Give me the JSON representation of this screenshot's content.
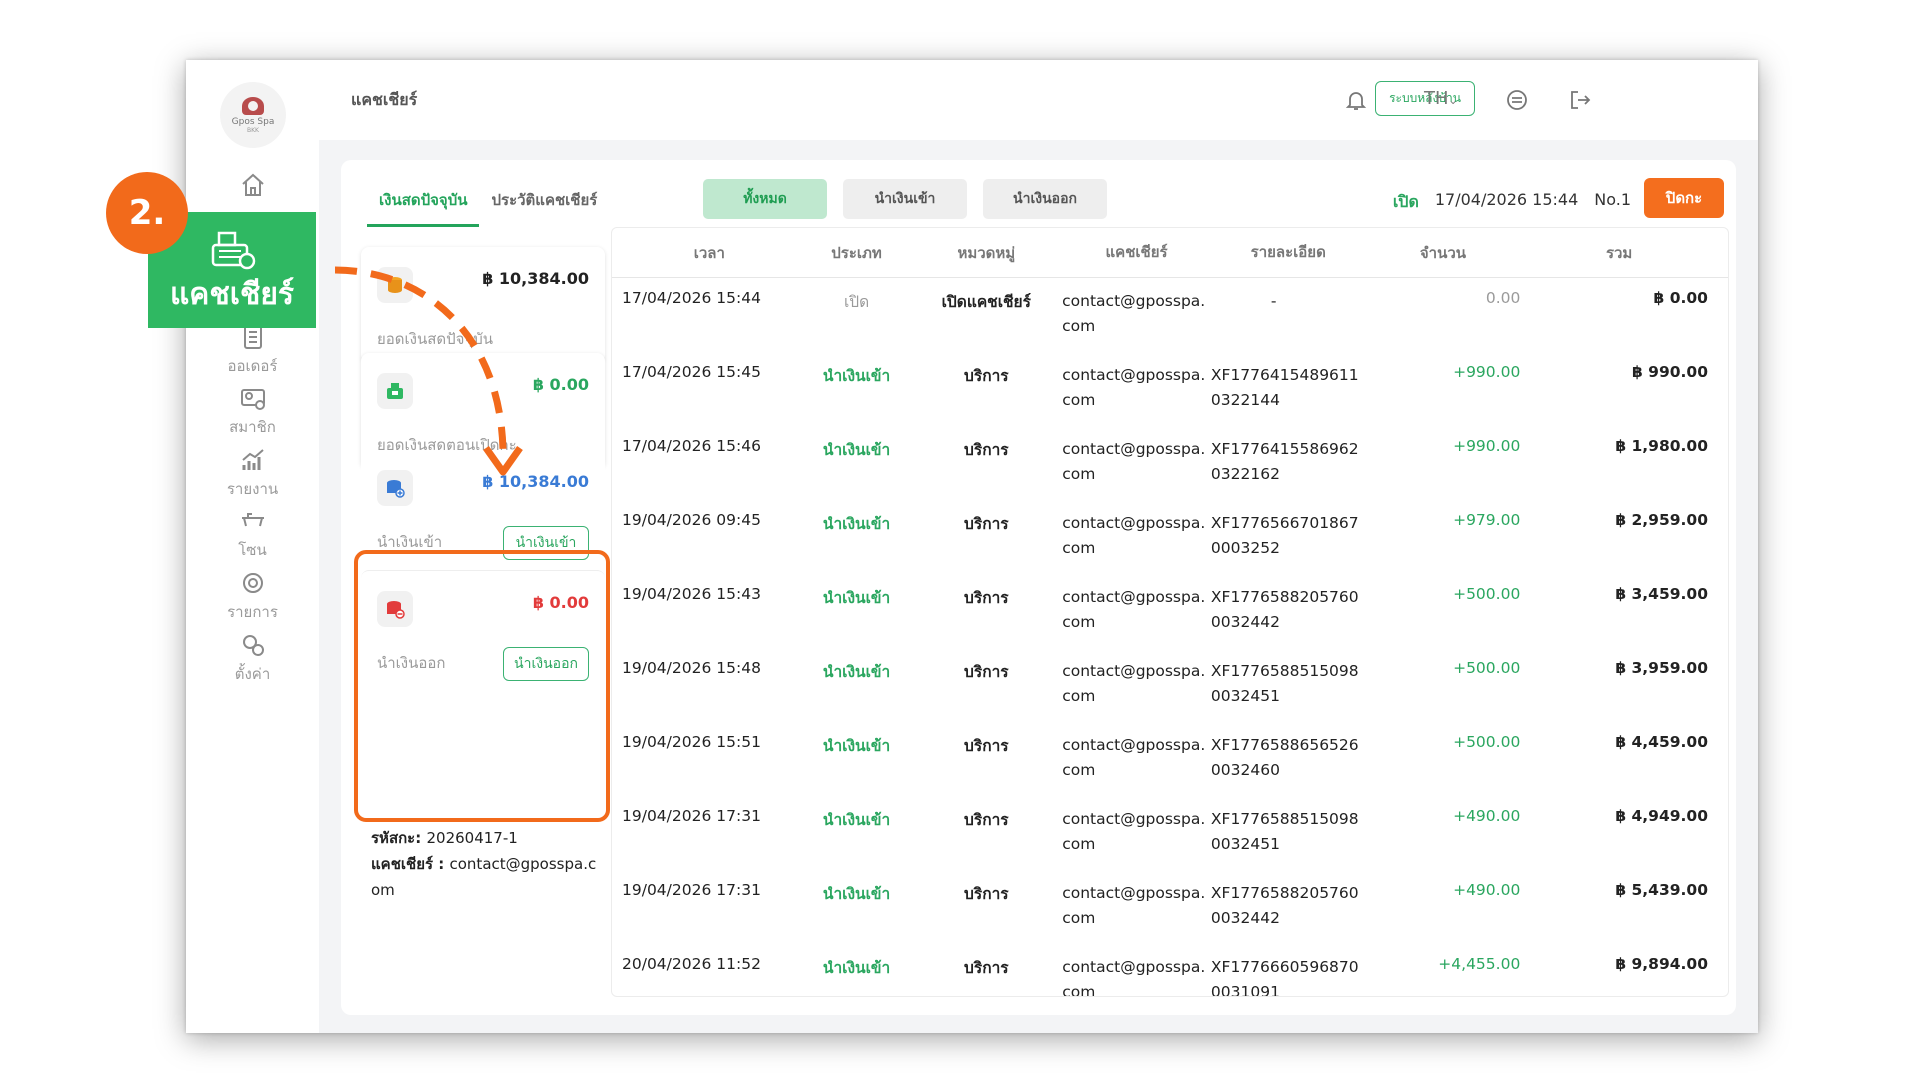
{
  "step_badge": "2.",
  "callout_label": "แคชเชียร์",
  "sidebar": {
    "logo_name": "Gpos Spa",
    "logo_sub": "BKK",
    "items": [
      {
        "label": "",
        "icon": "home-icon"
      },
      {
        "label": "",
        "icon": "cash-register-icon"
      },
      {
        "label": "ออเดอร์",
        "icon": "order-list-icon"
      },
      {
        "label": "สมาชิก",
        "icon": "member-card-icon"
      },
      {
        "label": "รายงาน",
        "icon": "report-chart-icon"
      },
      {
        "label": "โซน",
        "icon": "zone-bed-icon"
      },
      {
        "label": "รายการ",
        "icon": "item-list-icon"
      },
      {
        "label": "ตั้งค่า",
        "icon": "settings-gear-icon"
      }
    ]
  },
  "topbar": {
    "title": "แคชเชียร์",
    "backoffice_label": "ระบบหลังบ้าน",
    "language": "TH"
  },
  "tabs": [
    "เงินสดปัจจุบัน",
    "ประวัติแคชเชียร์"
  ],
  "filters": [
    "ทั้งหมด",
    "นำเงินเข้า",
    "นำเงินออก"
  ],
  "open_info": {
    "status": "เปิด",
    "datetime": "17/04/2026 15:44",
    "shift_no": "No.1",
    "close_button": "ปิดกะ"
  },
  "cards": [
    {
      "amount": "฿ 10,384.00",
      "label": "ยอดเงินสดปัจจุบัน"
    },
    {
      "amount": "฿ 0.00",
      "label": "ยอดเงินสดตอนเปิดกะ"
    },
    {
      "amount": "฿ 10,384.00",
      "label": "นำเงินเข้า",
      "button": "นำเงินเข้า"
    },
    {
      "amount": "฿ 0.00",
      "label": "นำเงินออก",
      "button": "นำเงินออก"
    }
  ],
  "meta": {
    "shift_code_label": "รหัสกะ:",
    "shift_code": "20260417-1",
    "cashier_label": "แคชเชียร์ :",
    "cashier": "contact@gposspa.com"
  },
  "table": {
    "headers": [
      "เวลา",
      "ประเภท",
      "หมวดหมู่",
      "แคชเชียร์",
      "รายละเอียด",
      "จำนวน",
      "รวม"
    ],
    "rows": [
      [
        "17/04/2026 15:44",
        "เปิด",
        "เปิดแคชเชียร์",
        "contact@gposspa.com",
        "-",
        "0.00",
        "฿ 0.00"
      ],
      [
        "17/04/2026 15:45",
        "นำเงินเข้า",
        "บริการ",
        "contact@gposspa.com",
        "XF17764154896110322144",
        "+990.00",
        "฿ 990.00"
      ],
      [
        "17/04/2026 15:46",
        "นำเงินเข้า",
        "บริการ",
        "contact@gposspa.com",
        "XF17764155869620322162",
        "+990.00",
        "฿ 1,980.00"
      ],
      [
        "19/04/2026 09:45",
        "นำเงินเข้า",
        "บริการ",
        "contact@gposspa.com",
        "XF17765667018670003252",
        "+979.00",
        "฿ 2,959.00"
      ],
      [
        "19/04/2026 15:43",
        "นำเงินเข้า",
        "บริการ",
        "contact@gposspa.com",
        "XF17765882057600032442",
        "+500.00",
        "฿ 3,459.00"
      ],
      [
        "19/04/2026 15:48",
        "นำเงินเข้า",
        "บริการ",
        "contact@gposspa.com",
        "XF17765885150980032451",
        "+500.00",
        "฿ 3,959.00"
      ],
      [
        "19/04/2026 15:51",
        "นำเงินเข้า",
        "บริการ",
        "contact@gposspa.com",
        "XF17765886565260032460",
        "+500.00",
        "฿ 4,459.00"
      ],
      [
        "19/04/2026 17:31",
        "นำเงินเข้า",
        "บริการ",
        "contact@gposspa.com",
        "XF17765885150980032451",
        "+490.00",
        "฿ 4,949.00"
      ],
      [
        "19/04/2026 17:31",
        "นำเงินเข้า",
        "บริการ",
        "contact@gposspa.com",
        "XF17765882057600032442",
        "+490.00",
        "฿ 5,439.00"
      ],
      [
        "20/04/2026 11:52",
        "นำเงินเข้า",
        "บริการ",
        "contact@gposspa.com",
        "XF17766605968700031091",
        "+4,455.00",
        "฿ 9,894.00"
      ]
    ]
  },
  "colors": {
    "accent_green": "#2aa65f",
    "accent_orange": "#f26a1b",
    "callout_green": "#2fb862"
  }
}
